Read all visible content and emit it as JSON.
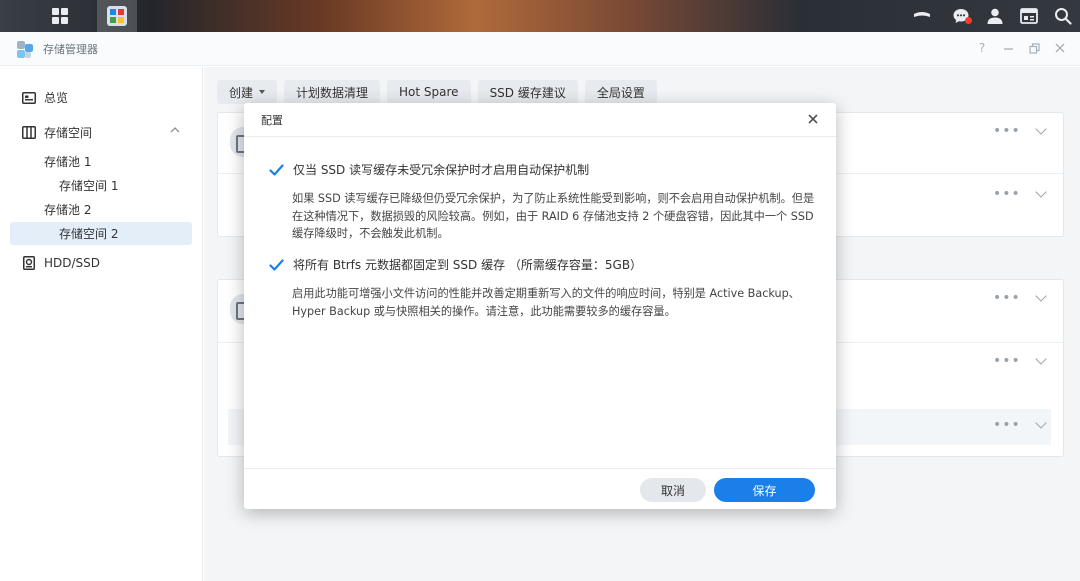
{
  "app": {
    "title": "存储管理器"
  },
  "sidebar": {
    "items": [
      {
        "label": "总览",
        "icon": "overview-icon"
      },
      {
        "label": "存储空间",
        "icon": "storage-icon"
      },
      {
        "label": "存储池 1"
      },
      {
        "label": "存储空间 1"
      },
      {
        "label": "存储池 2"
      },
      {
        "label": "存储空间 2",
        "selected": true
      },
      {
        "label": "HDD/SSD",
        "icon": "hdd-icon"
      }
    ]
  },
  "toolbar": {
    "create": "创建",
    "scrub": "计划数据清理",
    "hot_spare": "Hot Spare",
    "ssd_advice": "SSD 缓存建议",
    "global": "全局设置"
  },
  "dialog": {
    "title": "配置",
    "option1": {
      "label": "仅当 SSD 读写缓存未受冗余保护时才启用自动保护机制",
      "checked": true,
      "desc": [
        "如果 SSD 读写缓存已降级但仍受冗余保护，为了防止系统性能受到影响，则不会启用自动保护机制。但是",
        "在这种情况下，数据损毁的风险较高。例如，由于 RAID 6 存储池支持 2 个硬盘容错，因此其中一个 SSD",
        "缓存降级时，不会触发此机制。"
      ]
    },
    "option2": {
      "label": "将所有 Btrfs 元数据都固定到 SSD 缓存 （所需缓存容量：5GB）",
      "checked": true,
      "desc": [
        "启用此功能可增强小文件访问的性能并改善定期重新写入的文件的响应时间，特别是 Active Backup、",
        "Hyper Backup 或与快照相关的操作。请注意，此功能需要较多的缓存容量。"
      ]
    },
    "cancel": "取消",
    "save": "保存"
  },
  "colors": {
    "accent": "#1a7fe8",
    "selected_bg": "#e4eef9",
    "notification": "#ff3b30"
  }
}
